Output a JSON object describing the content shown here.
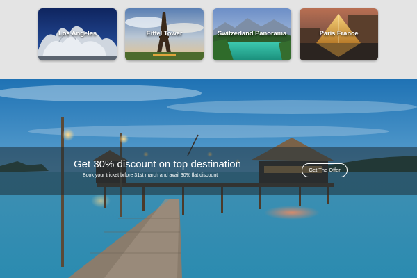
{
  "destinations": [
    {
      "label": "Los Angeles"
    },
    {
      "label": "Eiffel Tower"
    },
    {
      "label": "Switzerland Panorama"
    },
    {
      "label": "Paris France"
    }
  ],
  "promo": {
    "title": "Get 30% discount on top destination",
    "subtitle": "Book your tricket brfore 31st march and avail 30% flat discount",
    "button_label": "Get The Offer"
  },
  "colors": {
    "page_background": "#e4e4e4",
    "band_overlay": "rgba(30,45,55,0.55)",
    "text": "#ffffff"
  }
}
